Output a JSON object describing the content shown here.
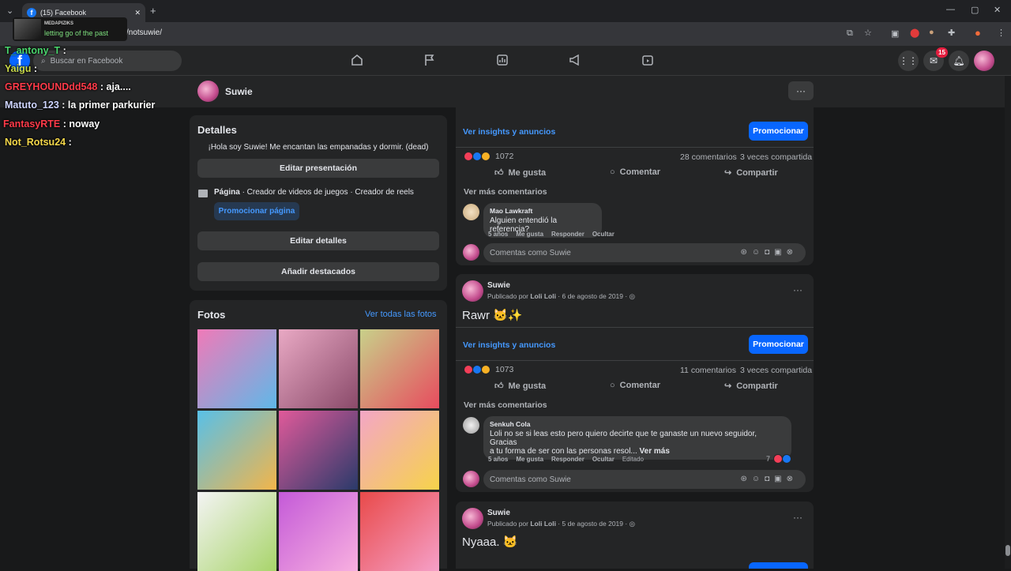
{
  "browser": {
    "tab_title": "(15) Facebook",
    "url": "/notsuwie/",
    "new_tab": "+",
    "close_tab": "✕"
  },
  "overlay": {
    "song_artist": "MEDAPIZIKS",
    "song_title": "letting go of the past",
    "chat": [
      {
        "user": "T_antony_T",
        "msg": ":",
        "color": "#4ad66d"
      },
      {
        "user": "Yaigu",
        "msg": ":",
        "color": "#c9d84a"
      },
      {
        "user": "GREYHOUNDdd548",
        "msg": ": aja....",
        "color": "#ff3b4a"
      },
      {
        "user": "Matuto_123",
        "msg": ": la primer parkurier",
        "color": "#cfd6ff"
      },
      {
        "user": "FantasyRTE",
        "msg": ": noway",
        "color": "#ff3b4a"
      },
      {
        "user": "Not_Rotsu24",
        "msg": ":",
        "color": "#f5d84a"
      }
    ]
  },
  "header": {
    "search_placeholder": "Buscar en Facebook",
    "notification_count": "15"
  },
  "page": {
    "name": "Suwie",
    "more": "···"
  },
  "details": {
    "title": "Detalles",
    "bio": "¡Hola soy Suwie! Me encantan las empanadas y dormir. (dead)",
    "edit_intro": "Editar presentación",
    "category_label": "Página",
    "category": " · Creador de videos de juegos · Creador de reels",
    "promote_page": "Promocionar página",
    "edit_details": "Editar detalles",
    "add_featured": "Añadir destacados"
  },
  "photos": {
    "title": "Fotos",
    "see_all": "Ver todas las fotos",
    "colors": [
      [
        "#f07ab8",
        "#5fb8e8"
      ],
      [
        "#e9a9c4",
        "#8a4a6a"
      ],
      [
        "#c8d08a",
        "#e74c5e"
      ],
      [
        "#58c0e8",
        "#f2b54a"
      ],
      [
        "#e05a9a",
        "#2a3a6a"
      ],
      [
        "#f3a6c6",
        "#f6d34a"
      ],
      [
        "#f4f4f4",
        "#a8d46a"
      ],
      [
        "#c45ad8",
        "#f8b0e0"
      ],
      [
        "#e94a4a",
        "#f5a0c8"
      ]
    ]
  },
  "feed": {
    "insights": "Ver insights y anuncios",
    "promote": "Promocionar",
    "like": "Me gusta",
    "comment": "Comentar",
    "share": "Compartir",
    "more_comments": "Ver más comentarios",
    "comment_as": "Comentas como Suwie",
    "post1": {
      "reactions": "1072",
      "comments": "28 comentarios",
      "shares": "3 veces compartida",
      "comment_author": "Mao Lawkraft",
      "comment_text": "Alguien entendió la referencia?",
      "time": "5 años",
      "meta_like": "Me gusta",
      "meta_reply": "Responder",
      "meta_hide": "Ocultar"
    },
    "post2": {
      "author": "Suwie",
      "published_by": "Publicado por",
      "publisher": "Loli Loli",
      "date": "6 de agosto de 2019",
      "text": "Rawr 🐱✨",
      "reactions": "1073",
      "comments": "11 comentarios",
      "shares": "3 veces compartida",
      "comment_author": "Senkuh Cola",
      "comment_text_1": "Loli no se si leas esto pero quiero decirte que te ganaste un nuevo seguidor, Gracias",
      "comment_text_2": "a tu forma de ser con las personas resol...",
      "see_more": "Ver más",
      "time": "5 años",
      "meta_like": "Me gusta",
      "meta_reply": "Responder",
      "meta_hide": "Ocultar",
      "meta_edited": "Editado",
      "comment_reactions": "7"
    },
    "post3": {
      "author": "Suwie",
      "published_by": "Publicado por",
      "publisher": "Loli Loli",
      "date": "5 de agosto de 2019",
      "text": "Nyaaa. 🐱"
    }
  }
}
